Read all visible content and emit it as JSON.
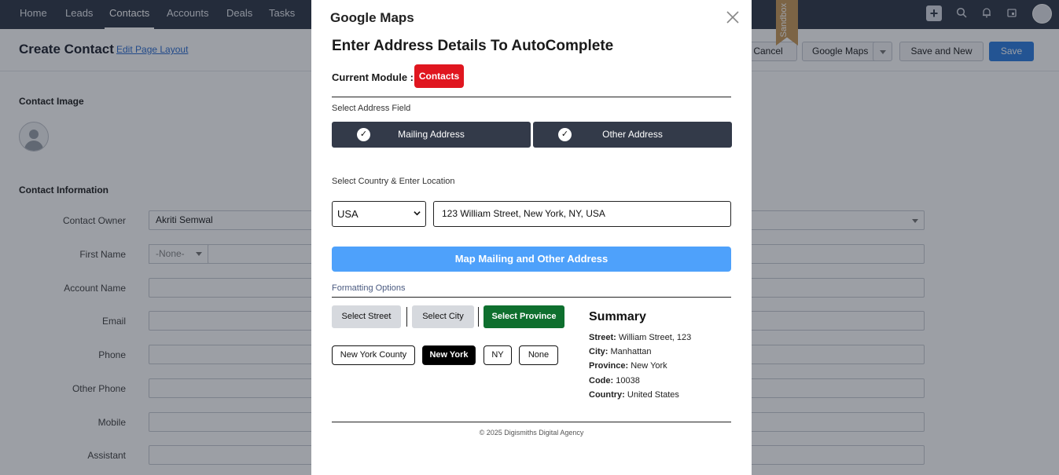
{
  "topnav": {
    "items": [
      "Home",
      "Leads",
      "Contacts",
      "Accounts",
      "Deals",
      "Tasks"
    ],
    "active": "Contacts"
  },
  "page": {
    "title": "Create Contact",
    "edit_layout": "Edit Page Layout",
    "buttons": {
      "cancel": "Cancel",
      "google_maps": "Google Maps",
      "save_and_new": "Save and New",
      "save": "Save"
    },
    "sandbox": "Sandbox",
    "sections": {
      "image": "Contact Image",
      "info": "Contact Information"
    },
    "fields": [
      {
        "label": "Contact Owner",
        "value": "Akriti Semwal"
      },
      {
        "label": "First Name",
        "value": ""
      },
      {
        "label": "Account Name",
        "value": ""
      },
      {
        "label": "Email",
        "value": ""
      },
      {
        "label": "Phone",
        "value": ""
      },
      {
        "label": "Other Phone",
        "value": ""
      },
      {
        "label": "Mobile",
        "value": ""
      },
      {
        "label": "Assistant",
        "value": ""
      }
    ],
    "salutation": "-None-"
  },
  "modal": {
    "title": "Google Maps",
    "heading": "Enter Address Details To AutoComplete",
    "module_label": "Current Module :",
    "module_value": "Contacts",
    "select_address_label": "Select Address Field",
    "address_fields": [
      "Mailing Address",
      "Other Address"
    ],
    "country_label": "Select Country & Enter Location",
    "country": "USA",
    "location": "123 William Street, New York, NY, USA",
    "map_button": "Map Mailing and Other Address",
    "formatting_label": "Formatting Options",
    "format_buttons": [
      "Select Street",
      "Select City",
      "Select Province"
    ],
    "format_active": "Select Province",
    "options": [
      "New York County",
      "New York",
      "NY",
      "None"
    ],
    "option_active": "New York",
    "summary": {
      "title": "Summary",
      "street_label": "Street:",
      "street": "William Street, 123",
      "city_label": "City:",
      "city": "Manhattan",
      "province_label": "Province:",
      "province": "New York",
      "code_label": "Code:",
      "code": "10038",
      "country_label": "Country:",
      "country": "United States"
    },
    "footer": "© 2025 Digismiths Digital Agency"
  },
  "colors": {
    "nav_bg": "#313949",
    "badge_red": "#e0161f",
    "map_button": "#4ea1fb",
    "province_active": "#0e6f2e",
    "address_button": "#333a49"
  }
}
